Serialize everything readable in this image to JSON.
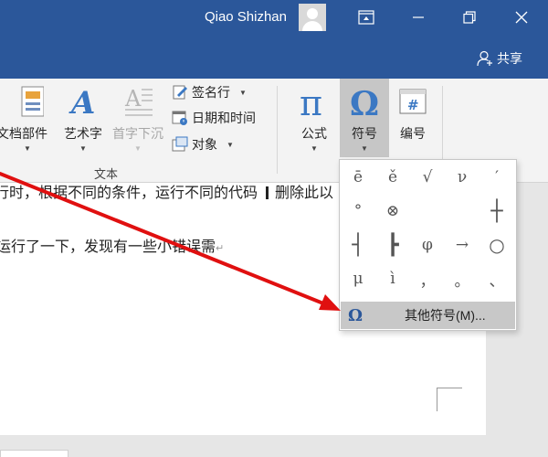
{
  "titlebar": {
    "user_name": "Qiao Shizhan",
    "avatar_icon": "user-avatar-icon",
    "buttons": [
      "ribbon-display-options-icon",
      "minimize-icon",
      "restore-icon",
      "close-icon"
    ]
  },
  "share": {
    "label": "共享",
    "icon": "share-person-icon"
  },
  "ribbon": {
    "text_group": {
      "label": "文本",
      "quick_parts": "文档部件",
      "wordart": "艺术字",
      "dropcap": "首字下沉",
      "signature_line": "签名行",
      "date_time": "日期和时间",
      "object": "对象"
    },
    "equation": "公式",
    "symbol": "符号",
    "numbering": "编号",
    "numbering_glyph": "#"
  },
  "document": {
    "line1": "行时，根据不同的条件，运行不同的代码",
    "line1_tail": "删除此以",
    "line2": "运行了一下，发现有一些小错误需",
    "paragraph_mark": "↵"
  },
  "symbol_menu": {
    "rows": [
      [
        "ē",
        "ě",
        "√",
        "ν",
        "′"
      ],
      [
        "°",
        "⊗",
        "",
        "",
        "┼"
      ],
      [
        "┤",
        "┣",
        "φ",
        "→",
        "○"
      ],
      [
        "μ",
        "ì",
        "，",
        "。",
        "、"
      ]
    ],
    "more_label": "其他符号(M)...",
    "more_glyph": "Ω"
  },
  "colors": {
    "accent": "#2b579a",
    "arrow": "#e01010"
  }
}
